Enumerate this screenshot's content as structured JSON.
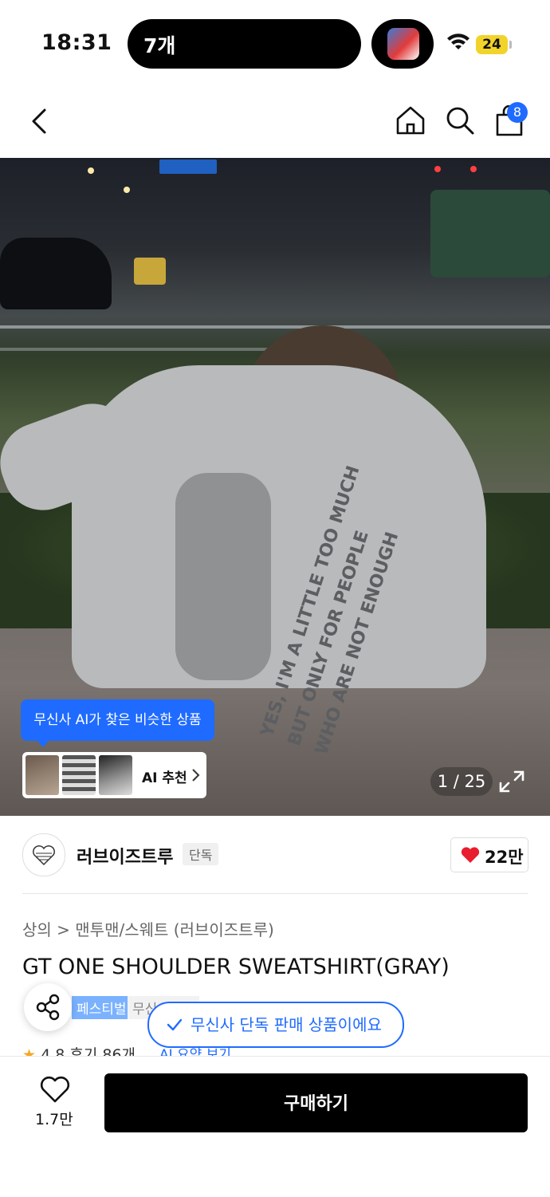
{
  "status_bar": {
    "time": "18:31",
    "island_text": "7개",
    "battery": "24"
  },
  "nav": {
    "cart_count": "8"
  },
  "hero": {
    "print_lines": [
      "YES, I'M A LITTLE TOO MUCH",
      "BUT ONLY FOR PEOPLE",
      "WHO ARE NOT ENOUGH"
    ],
    "ai_tooltip": "무신사 AI가 찾은 비슷한 상품",
    "ai_recommend_label": "AI 추천",
    "image_counter": "1 / 25"
  },
  "brand": {
    "name": "러브이즈트루",
    "badge": "단독",
    "like_count": "22만"
  },
  "product": {
    "breadcrumb": "상의 > 맨투맨/스웨트 (러브이즈트루)",
    "title": "GT ONE SHOULDER SWEATSHIRT(GRAY)",
    "tag_festival": "페스티벌",
    "tag_musinsa": "무신사단독",
    "exclusive_notice": "무신사 단독 판매 상품이에요",
    "rating": "4.8",
    "reviews": "후기 86개",
    "ai_summary": "AI 요약 보기"
  },
  "bottom": {
    "wish_count": "1.7만",
    "buy_label": "구매하기"
  },
  "colors": {
    "accent": "#1f6bff",
    "heart": "#e81d2d",
    "buy": "#000000"
  }
}
